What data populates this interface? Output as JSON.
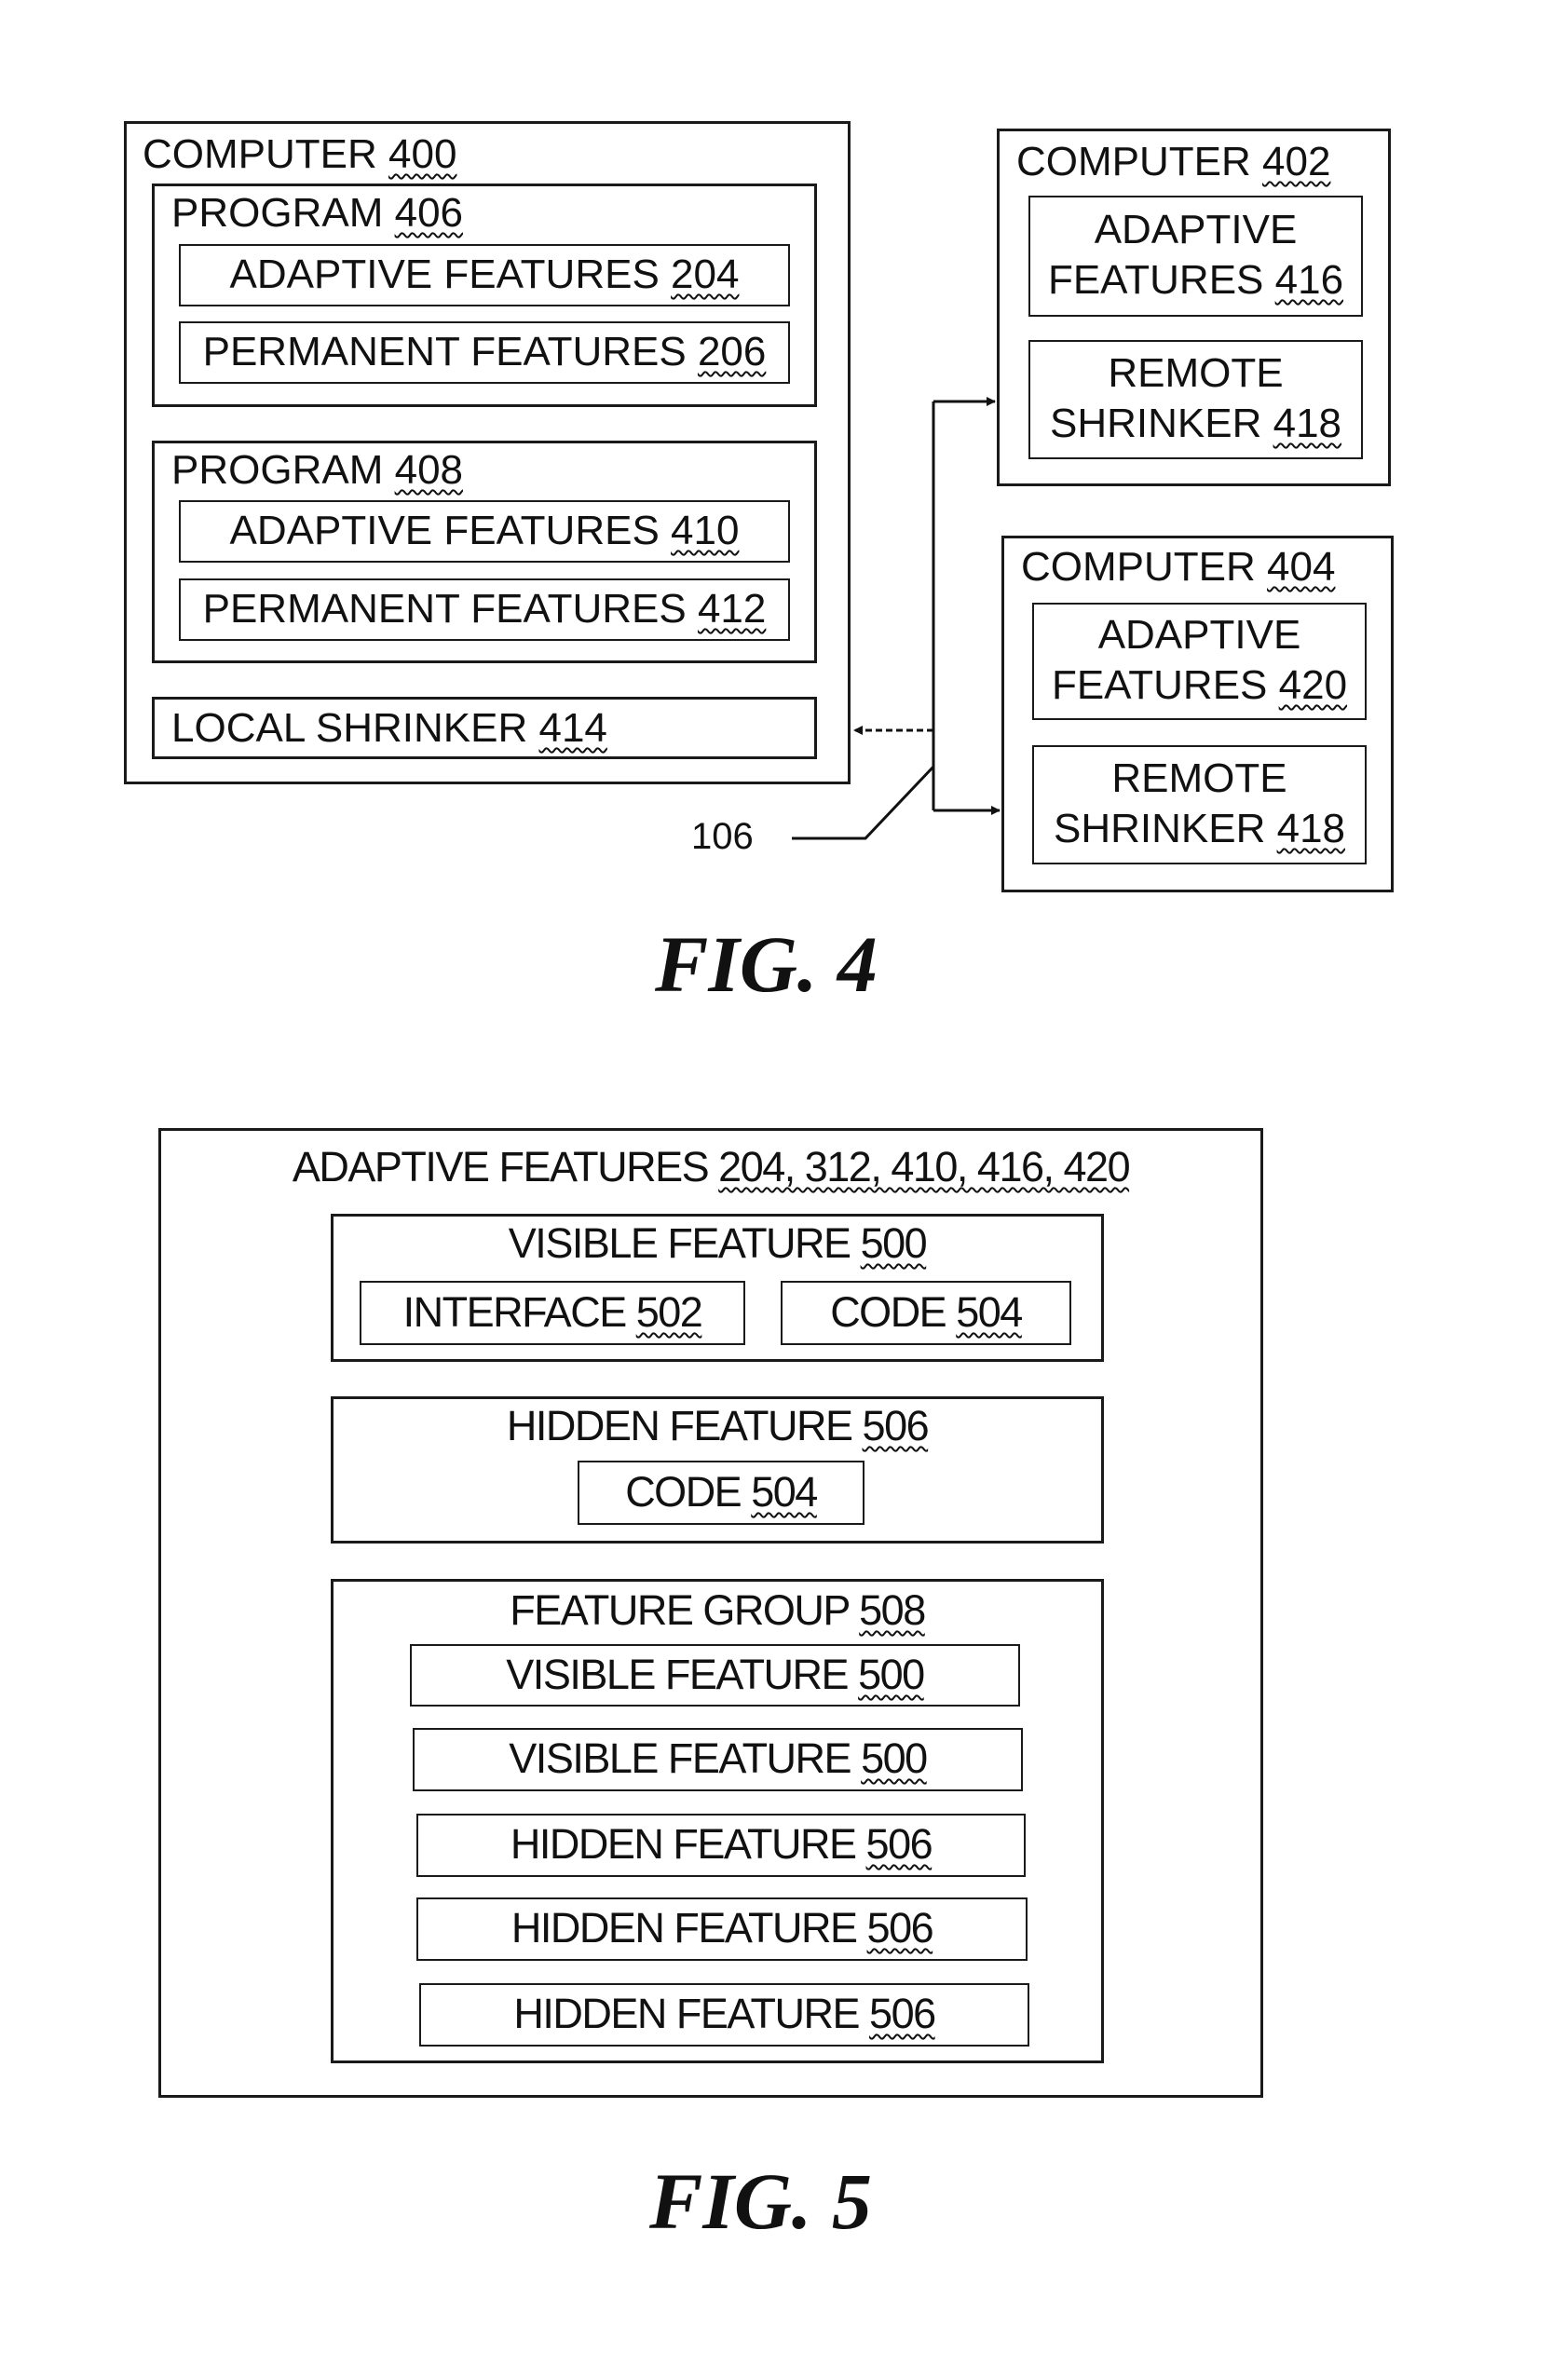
{
  "fig4": {
    "caption": "FIG. 4",
    "computer400": {
      "label": "COMPUTER",
      "num": "400",
      "program406": {
        "label": "PROGRAM",
        "num": "406",
        "adaptive": {
          "label": "ADAPTIVE FEATURES",
          "num": "204"
        },
        "permanent": {
          "label": "PERMANENT FEATURES",
          "num": "206"
        }
      },
      "program408": {
        "label": "PROGRAM",
        "num": "408",
        "adaptive": {
          "label": "ADAPTIVE FEATURES",
          "num": "410"
        },
        "permanent": {
          "label": "PERMANENT FEATURES",
          "num": "412"
        }
      },
      "local_shrinker": {
        "label": "LOCAL SHRINKER",
        "num": "414"
      }
    },
    "computer402": {
      "label": "COMPUTER",
      "num": "402",
      "adaptive": {
        "line1": "ADAPTIVE",
        "line2": "FEATURES",
        "num": "416"
      },
      "remote": {
        "line1": "REMOTE",
        "line2": "SHRINKER",
        "num": "418"
      }
    },
    "computer404": {
      "label": "COMPUTER",
      "num": "404",
      "adaptive": {
        "line1": "ADAPTIVE",
        "line2": "FEATURES",
        "num": "420"
      },
      "remote": {
        "line1": "REMOTE",
        "line2": "SHRINKER",
        "num": "418"
      }
    },
    "network_ref": "106"
  },
  "fig5": {
    "caption": "FIG. 5",
    "outer": {
      "label": "ADAPTIVE FEATURES",
      "num": "204, 312, 410, 416, 420"
    },
    "visible": {
      "label": "VISIBLE FEATURE",
      "num": "500",
      "interface": {
        "label": "INTERFACE",
        "num": "502"
      },
      "code": {
        "label": "CODE",
        "num": "504"
      }
    },
    "hidden": {
      "label": "HIDDEN FEATURE",
      "num": "506",
      "code": {
        "label": "CODE",
        "num": "504"
      }
    },
    "group": {
      "label": "FEATURE GROUP",
      "num": "508",
      "items": [
        {
          "label": "VISIBLE FEATURE",
          "num": "500"
        },
        {
          "label": "VISIBLE FEATURE",
          "num": "500"
        },
        {
          "label": "HIDDEN FEATURE",
          "num": "506"
        },
        {
          "label": "HIDDEN FEATURE",
          "num": "506"
        },
        {
          "label": "HIDDEN FEATURE",
          "num": "506"
        }
      ]
    }
  }
}
